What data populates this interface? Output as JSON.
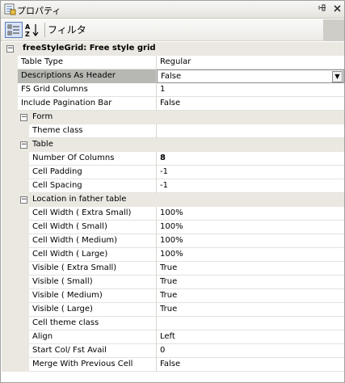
{
  "window": {
    "title": "プロパティ",
    "icons": {
      "title": "properties-icon",
      "pin": "pin-icon",
      "close": "close-icon"
    },
    "pin_glyph": "ᵖ",
    "close_glyph": "x"
  },
  "toolbar": {
    "categorized_icon": "categorized-icon",
    "alphabetical_icon": "alphabetical-sort-icon",
    "filter_label": "フィルタ"
  },
  "grid": {
    "object_header": "freeStyleGrid: Free style grid",
    "top_properties": [
      {
        "name": "Table Type",
        "value": "Regular"
      },
      {
        "name": "Descriptions As Header",
        "value": "False",
        "selected": true,
        "has_dropdown": true
      },
      {
        "name": "FS Grid Columns",
        "value": "1"
      },
      {
        "name": "Include Pagination Bar",
        "value": "False"
      }
    ],
    "sections": [
      {
        "title": "Form",
        "properties": [
          {
            "name": "Theme class",
            "value": ""
          }
        ]
      },
      {
        "title": "Table",
        "properties": [
          {
            "name": "Number Of Columns",
            "value": "8",
            "bold": true
          },
          {
            "name": "Cell Padding",
            "value": "-1"
          },
          {
            "name": "Cell Spacing",
            "value": "-1"
          }
        ]
      },
      {
        "title": "Location in father table",
        "properties": [
          {
            "name": "Cell Width ( Extra Small)",
            "value": "100%"
          },
          {
            "name": "Cell Width ( Small)",
            "value": "100%"
          },
          {
            "name": "Cell Width ( Medium)",
            "value": "100%"
          },
          {
            "name": "Cell Width ( Large)",
            "value": "100%"
          },
          {
            "name": "Visible ( Extra Small)",
            "value": "True"
          },
          {
            "name": "Visible ( Small)",
            "value": "True"
          },
          {
            "name": "Visible ( Medium)",
            "value": "True"
          },
          {
            "name": "Visible ( Large)",
            "value": "True"
          },
          {
            "name": "Cell theme class",
            "value": ""
          },
          {
            "name": "Align",
            "value": "Left"
          },
          {
            "name": "Start Col/ Fst Avail",
            "value": "0"
          },
          {
            "name": "Merge With Previous Cell",
            "value": "False"
          }
        ]
      }
    ],
    "expander_glyph": "−",
    "dropdown_glyph": "▼"
  },
  "colors": {
    "gutter": "#eae8e0",
    "selected_name": "#b7b7b3",
    "grid_line": "#e3e2dc"
  }
}
